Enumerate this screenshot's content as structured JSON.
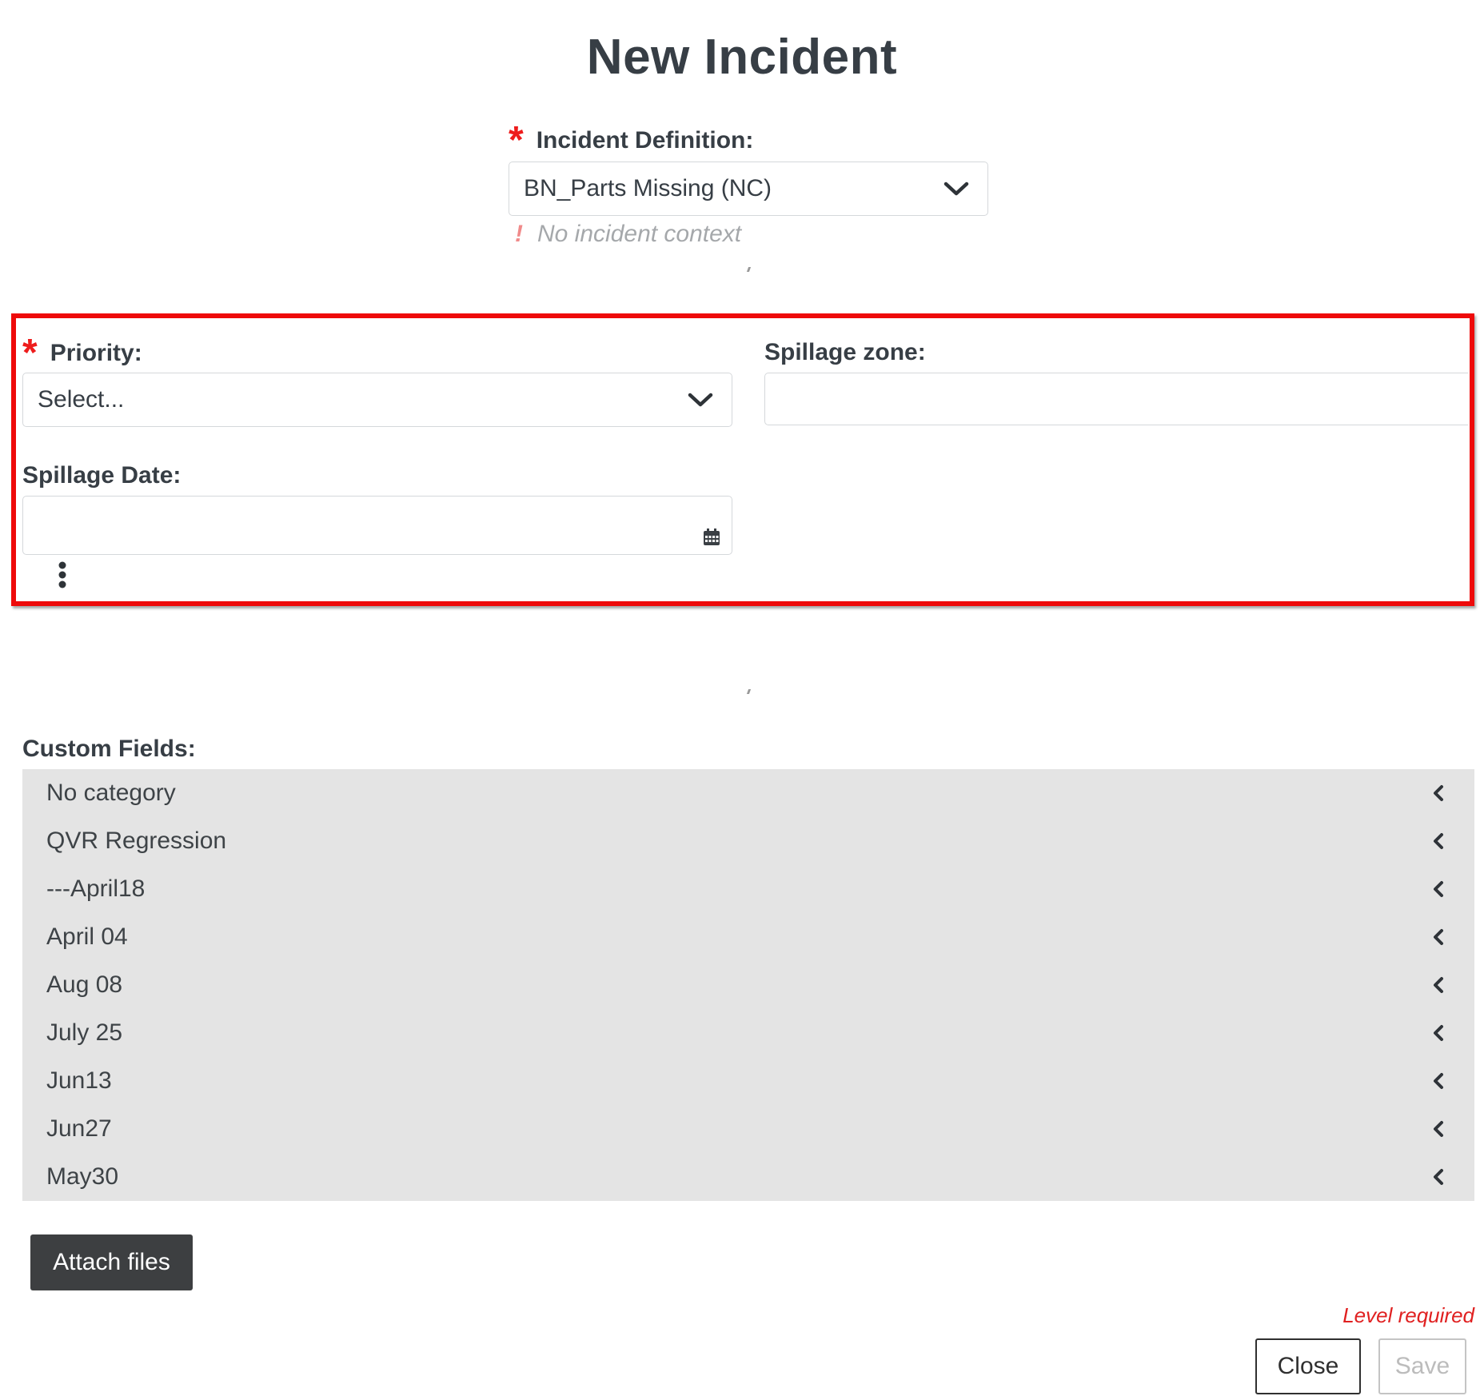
{
  "header": {
    "title": "New Incident"
  },
  "incident_definition": {
    "required_mark": "*",
    "label": "Incident Definition:",
    "value": "BN_Parts Missing (NC)",
    "warning_mark": "!",
    "warning_text": "No incident context"
  },
  "priority": {
    "required_mark": "*",
    "label": "Priority:",
    "value": "Select..."
  },
  "spillage_zone": {
    "label": "Spillage zone:",
    "value": ""
  },
  "spillage_date": {
    "label": "Spillage Date:",
    "value": ""
  },
  "custom_fields": {
    "label": "Custom Fields:",
    "categories": [
      {
        "label": "No category"
      },
      {
        "label": "QVR Regression"
      },
      {
        "label": "---April18"
      },
      {
        "label": "April 04"
      },
      {
        "label": "Aug 08"
      },
      {
        "label": "July 25"
      },
      {
        "label": "Jun13"
      },
      {
        "label": "Jun27"
      },
      {
        "label": "May30"
      }
    ]
  },
  "footer": {
    "attach_label": "Attach files",
    "level_required": "Level required",
    "close_label": "Close",
    "save_label": "Save"
  },
  "colors": {
    "required": "#ee1c1c",
    "highlight_border": "#ee0a0a",
    "panel_bg": "#e4e4e4",
    "attach_bg": "#3d3f41"
  },
  "icons": [
    "chevron-down-icon",
    "calendar-icon",
    "kebab-menu-icon",
    "chevron-left-icon"
  ]
}
